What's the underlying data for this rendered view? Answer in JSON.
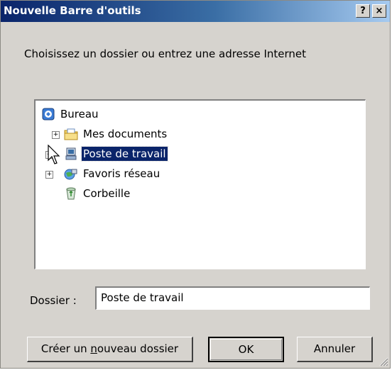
{
  "window": {
    "title": "Nouvelle Barre d'outils",
    "help_label": "?",
    "close_label": "×"
  },
  "instruction": "Choisissez un dossier ou entrez une adresse Internet",
  "tree": {
    "items": [
      {
        "label": "Bureau",
        "icon": "desktop-icon",
        "expander": ""
      },
      {
        "label": "Mes documents",
        "icon": "my-documents-folder-icon",
        "expander": "+"
      },
      {
        "label": "Poste de travail",
        "icon": "my-computer-icon",
        "expander": "+",
        "selected": true
      },
      {
        "label": "Favoris réseau",
        "icon": "network-places-icon",
        "expander": "+"
      },
      {
        "label": "Corbeille",
        "icon": "recycle-bin-icon",
        "expander": ""
      }
    ]
  },
  "folder": {
    "label": "Dossier :",
    "value": "Poste de travail"
  },
  "buttons": {
    "new_folder": {
      "before": "Créer un ",
      "mnemonic": "n",
      "after": "ouveau dossier"
    },
    "ok": "OK",
    "cancel": "Annuler"
  },
  "colors": {
    "dialog_face": "#d6d3ce",
    "title_gradient_start": "#0a246a",
    "title_gradient_end": "#a6caf0",
    "selection": "#0a246a"
  }
}
